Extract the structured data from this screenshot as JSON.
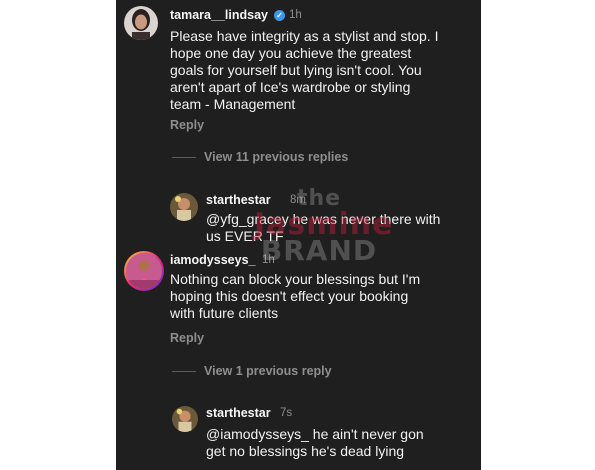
{
  "comments": [
    {
      "username": "tamara__lindsay",
      "verified": true,
      "time": "1h",
      "lines": [
        "Please have integrity as a stylist and stop. I",
        "hope one day you achieve the greatest",
        "goals for yourself but lying isn't cool. You",
        "aren't apart of Ice's wardrobe or styling",
        "team - Management"
      ],
      "reply_label": "Reply"
    },
    {
      "username": "iamodysseys_",
      "time": "1h",
      "lines": [
        "Nothing can block your blessings but I'm",
        "hoping this doesn't effect your booking",
        "with future clients"
      ],
      "reply_label": "Reply"
    }
  ],
  "view_replies": [
    {
      "label": "View 11 previous replies"
    },
    {
      "label": "View 1 previous reply"
    }
  ],
  "replies": [
    {
      "username": "starthestar",
      "time": "8m",
      "lines": [
        "@yfg_gracey he was never there with",
        "us EVER TF"
      ]
    },
    {
      "username": "starthestar",
      "time": "7s",
      "lines": [
        "@iamodysseys_ he ain't never gon",
        "get no blessings he's dead lying"
      ]
    }
  ],
  "watermark": {
    "line1": "the",
    "line2": "Jasmine",
    "line3": "BRAND"
  },
  "colors": {
    "background": "#1f1f1f",
    "text": "#f2f2f2",
    "muted": "#8e8e8e",
    "verified": "#3897f0"
  }
}
